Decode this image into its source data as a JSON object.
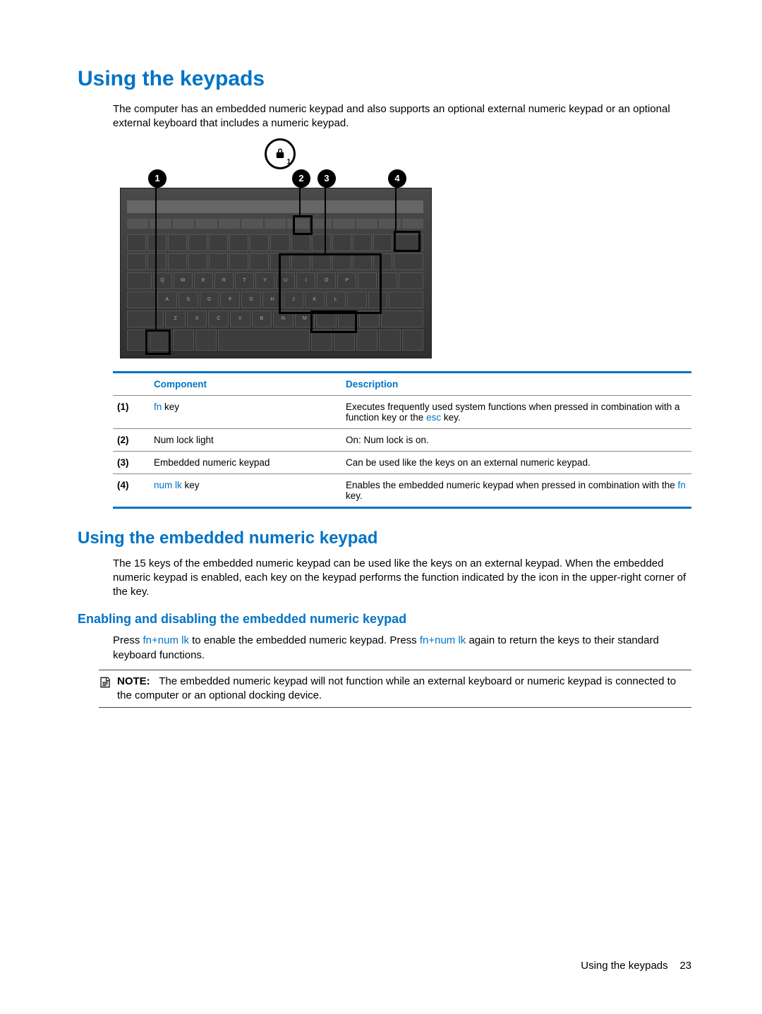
{
  "headings": {
    "h1": "Using the keypads",
    "h2": "Using the embedded numeric keypad",
    "h3": "Enabling and disabling the embedded numeric keypad"
  },
  "intro": "The computer has an embedded numeric keypad and also supports an optional external numeric keypad or an optional external keyboard that includes a numeric keypad.",
  "callouts": {
    "c1": "1",
    "c2": "2",
    "c3": "3",
    "c4": "4",
    "lock_sub": "1"
  },
  "table": {
    "head_component": "Component",
    "head_description": "Description",
    "rows": [
      {
        "num": "(1)",
        "comp_link": "fn",
        "comp_after": " key",
        "desc_before": "Executes frequently used system functions when pressed in combination with a function key or the ",
        "desc_link": "esc",
        "desc_after": " key."
      },
      {
        "num": "(2)",
        "comp_plain": "Num lock light",
        "desc_plain": "On: Num lock is on."
      },
      {
        "num": "(3)",
        "comp_plain": "Embedded numeric keypad",
        "desc_plain": "Can be used like the keys on an external numeric keypad."
      },
      {
        "num": "(4)",
        "comp_link": "num lk",
        "comp_after": " key",
        "desc_before": "Enables the embedded numeric keypad when pressed in combination with the ",
        "desc_link": "fn",
        "desc_after": " key."
      }
    ]
  },
  "para2": "The 15 keys of the embedded numeric keypad can be used like the keys on an external keypad. When the embedded numeric keypad is enabled, each key on the keypad performs the function indicated by the icon in the upper-right corner of the key.",
  "enable": {
    "t1": "Press ",
    "l1": "fn+num lk",
    "t2": " to enable the embedded numeric keypad. Press ",
    "l2": "fn+num lk",
    "t3": " again to return the keys to their standard keyboard functions."
  },
  "note": {
    "label": "NOTE:",
    "text": "The embedded numeric keypad will not function while an external keyboard or numeric keypad is connected to the computer or an optional docking device."
  },
  "footer": {
    "text": "Using the keypads",
    "page": "23"
  }
}
